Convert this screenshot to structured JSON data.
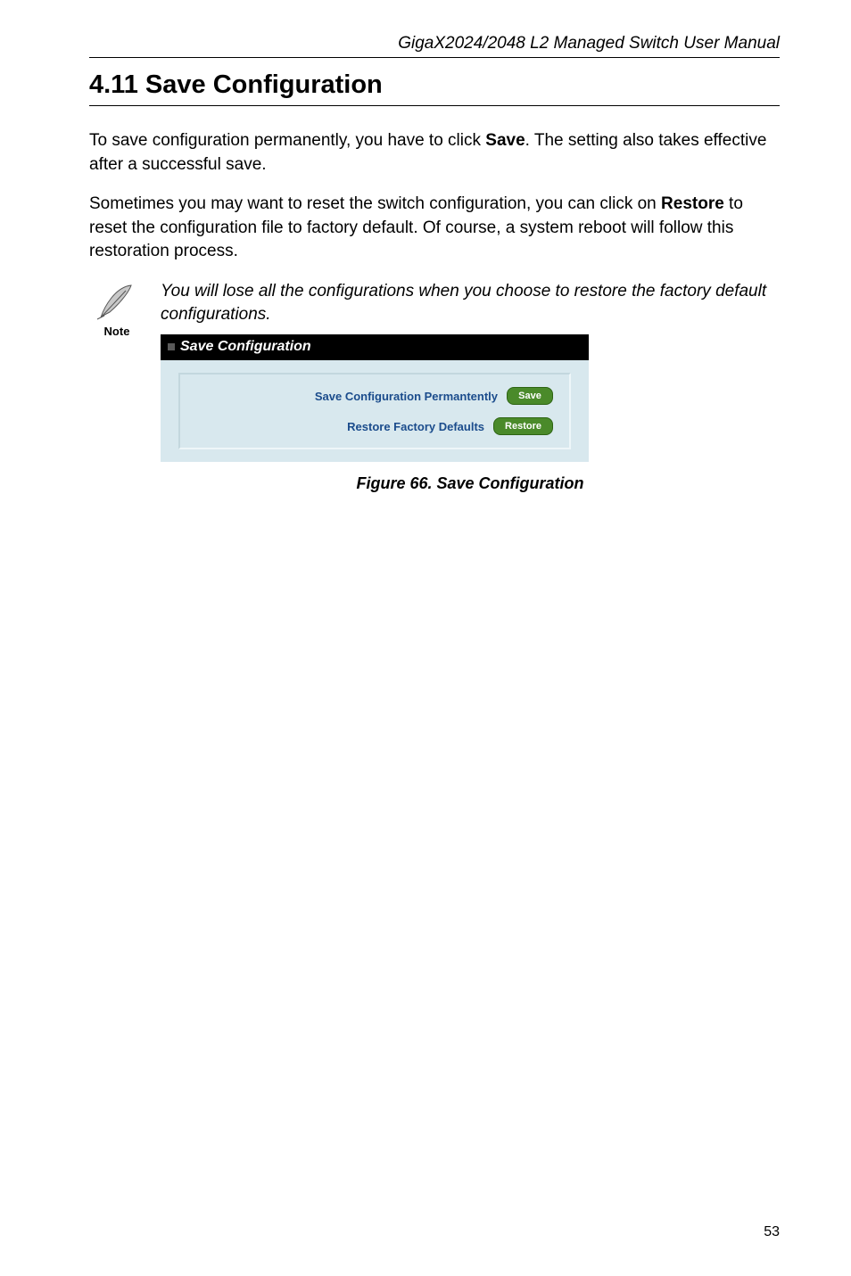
{
  "header": {
    "running_title": "GigaX2024/2048 L2 Managed Switch User Manual"
  },
  "section": {
    "number": "4.11",
    "title": "Save Configuration"
  },
  "paragraphs": {
    "p1_a": "To save configuration permanently, you have to click ",
    "p1_bold": "Save",
    "p1_b": ". The setting also takes effective after a successful save.",
    "p2_a": "Sometimes you may want to reset the switch configuration, you can click on ",
    "p2_bold": "Restore",
    "p2_b": " to reset the configuration file to factory default. Of course, a system reboot will follow this restoration process."
  },
  "note": {
    "label": "Note",
    "text": "You will lose all the configurations when you choose to restore the factory default configurations."
  },
  "screenshot": {
    "titlebar": "Save Configuration",
    "row1_label": "Save Configuration Permantently",
    "row1_button": "Save",
    "row2_label": "Restore Factory Defaults",
    "row2_button": "Restore"
  },
  "figure_caption": "Figure 66. Save Configuration",
  "page_number": "53"
}
